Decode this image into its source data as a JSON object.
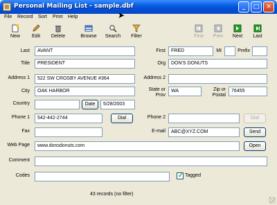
{
  "window": {
    "title": "Personal Mailing List - sample.dbf"
  },
  "menu": [
    "File",
    "Record",
    "Sort",
    "Print",
    "Help"
  ],
  "toolbar": {
    "new": "New",
    "edit": "Edit",
    "delete": "Delete",
    "browse": "Browse",
    "search": "Search",
    "filter": "Filter",
    "first": "First",
    "prev": "Prev",
    "next": "Next",
    "last": "Last"
  },
  "labels": {
    "last": "Last",
    "first": "First",
    "mi": "MI",
    "prefix": "Prefix",
    "title": "Title",
    "org": "Org",
    "address1": "Address 1",
    "address2": "Address 2",
    "city": "City",
    "state": "State or Prov",
    "zip": "Zip or Postal",
    "country": "Country",
    "phone1": "Phone 1",
    "phone2": "Phone 2",
    "fax": "Fax",
    "email": "E-mail",
    "webpage": "Web Page",
    "comment": "Comment",
    "codes": "Codes",
    "tagged": "Tagged"
  },
  "values": {
    "last": "AVANT",
    "first": "FRED",
    "mi": "",
    "prefix": "",
    "title": "PRESIDENT",
    "org": "DON'S DONUTS",
    "address1": "522 SW CROSBY AVENUE #364",
    "address2": "",
    "city": "OAK HARBOR",
    "state": "WA",
    "zip": "76455",
    "country": "",
    "date": "5/28/2003",
    "phone1": "542-442-2744",
    "phone2": "",
    "fax": "",
    "email": "ABC@XYZ.COM",
    "webpage": "www.donsdonuts.com",
    "comment": "",
    "codes": "",
    "tagged": true
  },
  "buttons": {
    "date": "Date",
    "dial": "Dial",
    "send": "Send",
    "open": "Open"
  },
  "status": "43 records (no filter)"
}
